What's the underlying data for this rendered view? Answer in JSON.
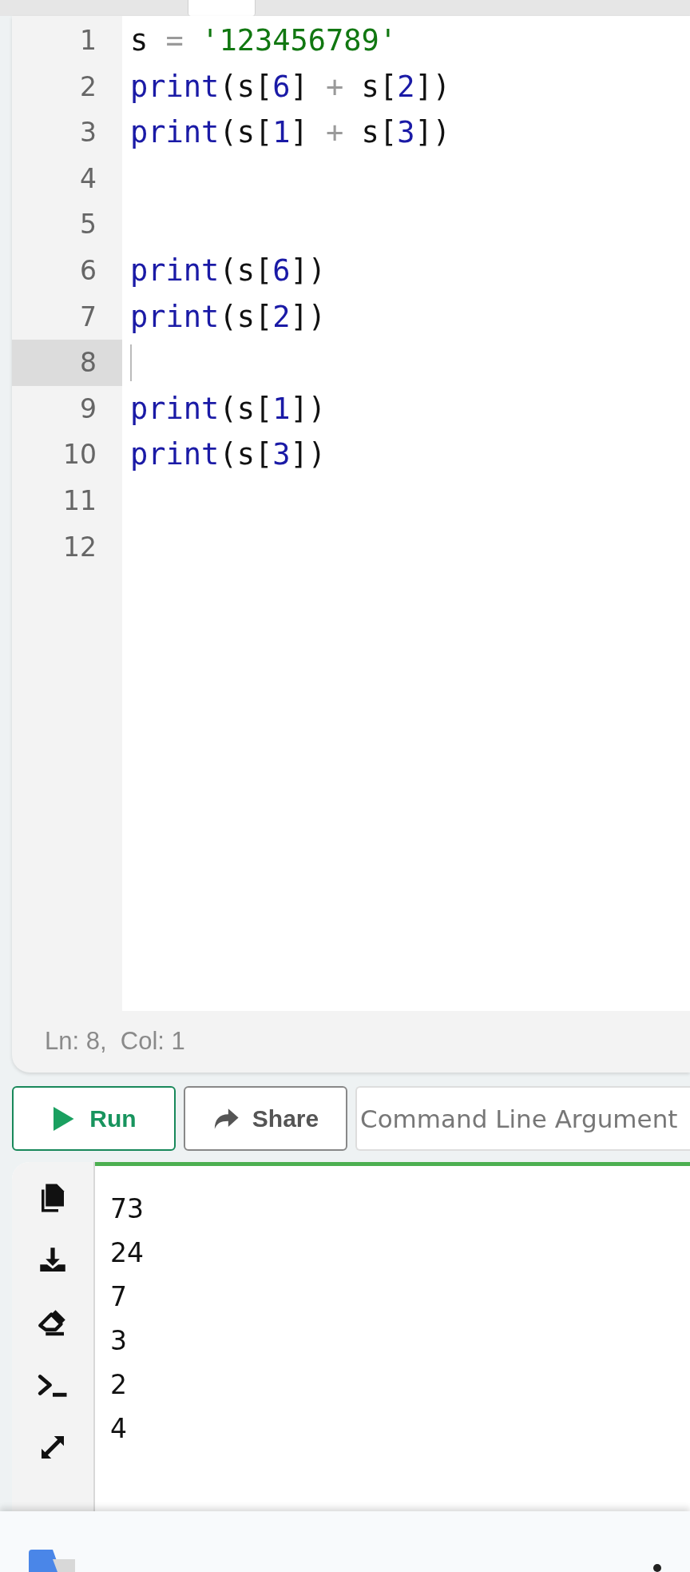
{
  "editor": {
    "lines": [
      {
        "number": "1",
        "current": false,
        "tokens": [
          {
            "text": "s",
            "kind": "name"
          },
          {
            "text": " = ",
            "kind": "op"
          },
          {
            "text": "'123456789'",
            "kind": "string"
          }
        ]
      },
      {
        "number": "2",
        "current": false,
        "tokens": [
          {
            "text": "print",
            "kind": "builtin"
          },
          {
            "text": "(s[",
            "kind": "name"
          },
          {
            "text": "6",
            "kind": "number"
          },
          {
            "text": "] ",
            "kind": "name"
          },
          {
            "text": "+",
            "kind": "op"
          },
          {
            "text": " s[",
            "kind": "name"
          },
          {
            "text": "2",
            "kind": "number"
          },
          {
            "text": "])",
            "kind": "name"
          }
        ]
      },
      {
        "number": "3",
        "current": false,
        "tokens": [
          {
            "text": "print",
            "kind": "builtin"
          },
          {
            "text": "(s[",
            "kind": "name"
          },
          {
            "text": "1",
            "kind": "number"
          },
          {
            "text": "] ",
            "kind": "name"
          },
          {
            "text": "+",
            "kind": "op"
          },
          {
            "text": " s[",
            "kind": "name"
          },
          {
            "text": "3",
            "kind": "number"
          },
          {
            "text": "])",
            "kind": "name"
          }
        ]
      },
      {
        "number": "4",
        "current": false
      },
      {
        "number": "5",
        "current": false
      },
      {
        "number": "6",
        "current": false,
        "tokens": [
          {
            "text": "print",
            "kind": "builtin"
          },
          {
            "text": "(s[",
            "kind": "name"
          },
          {
            "text": "6",
            "kind": "number"
          },
          {
            "text": "])",
            "kind": "name"
          }
        ]
      },
      {
        "number": "7",
        "current": false,
        "tokens": [
          {
            "text": "print",
            "kind": "builtin"
          },
          {
            "text": "(s[",
            "kind": "name"
          },
          {
            "text": "2",
            "kind": "number"
          },
          {
            "text": "])",
            "kind": "name"
          }
        ]
      },
      {
        "number": "8",
        "current": true
      },
      {
        "number": "9",
        "current": false,
        "tokens": [
          {
            "text": "print",
            "kind": "builtin"
          },
          {
            "text": "(s[",
            "kind": "name"
          },
          {
            "text": "1",
            "kind": "number"
          },
          {
            "text": "])",
            "kind": "name"
          }
        ]
      },
      {
        "number": "10",
        "current": false,
        "tokens": [
          {
            "text": "print",
            "kind": "builtin"
          },
          {
            "text": "(s[",
            "kind": "name"
          },
          {
            "text": "3",
            "kind": "number"
          },
          {
            "text": "])",
            "kind": "name"
          }
        ]
      },
      {
        "number": "11",
        "current": false
      },
      {
        "number": "12",
        "current": false
      }
    ],
    "status": "Ln: 8,  Col: 1"
  },
  "toolbar": {
    "run": "Run",
    "share": "Share",
    "arguments_placeholder": "Command Line Argument"
  },
  "output": {
    "lines": [
      "73",
      "24",
      "7",
      "3",
      "2",
      "4"
    ]
  }
}
